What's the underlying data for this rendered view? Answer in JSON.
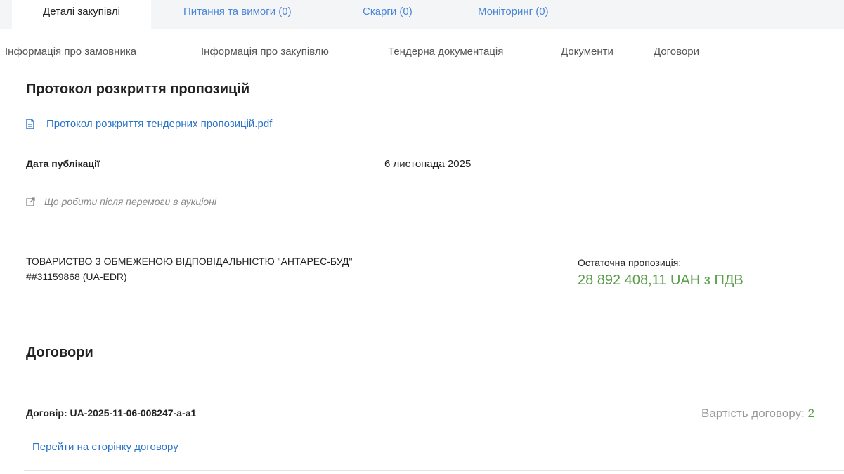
{
  "tabs": [
    {
      "label": "Деталі закупівлі",
      "active": true
    },
    {
      "label": "Питання та вимоги (0)",
      "active": false
    },
    {
      "label": "Скарги (0)",
      "active": false
    },
    {
      "label": "Моніторинг (0)",
      "active": false
    }
  ],
  "subnav": [
    "Інформація про замовника",
    "Інформація про закупівлю",
    "Тендерна документація",
    "Документи",
    "Договори"
  ],
  "protocol": {
    "title": "Протокол розкриття пропозицій",
    "file_link": "Протокол розкриття тендерних пропозицій.pdf",
    "file_icon": "document-icon",
    "date_label": "Дата публікації",
    "date_value": "6 листопада 2025",
    "hint": "Що робити після перемоги в аукціоні",
    "hint_icon": "external-link-icon"
  },
  "bidder": {
    "name": "ТОВАРИСТВО З ОБМЕЖЕНОЮ ВІДПОВІДАЛЬНІСТЮ \"АНТАРЕС-БУД\"",
    "id": "##31159868 (UA-EDR)",
    "offer_label": "Остаточна пропозиція:",
    "offer_value": "28 892 408,11 UAH з ПДВ"
  },
  "contracts": {
    "title": "Договори",
    "contract_label": "Договір: UA-2025-11-06-008247-a-a1",
    "cost_label": "Вартість договору: ",
    "cost_value_partial": "2",
    "open_link": "Перейти на сторінку договору"
  },
  "colors": {
    "link": "#2a74c8",
    "tab_link": "#4a86d8",
    "price_green": "#5a9e4b",
    "tabbar_bg": "#f4f5f7"
  }
}
